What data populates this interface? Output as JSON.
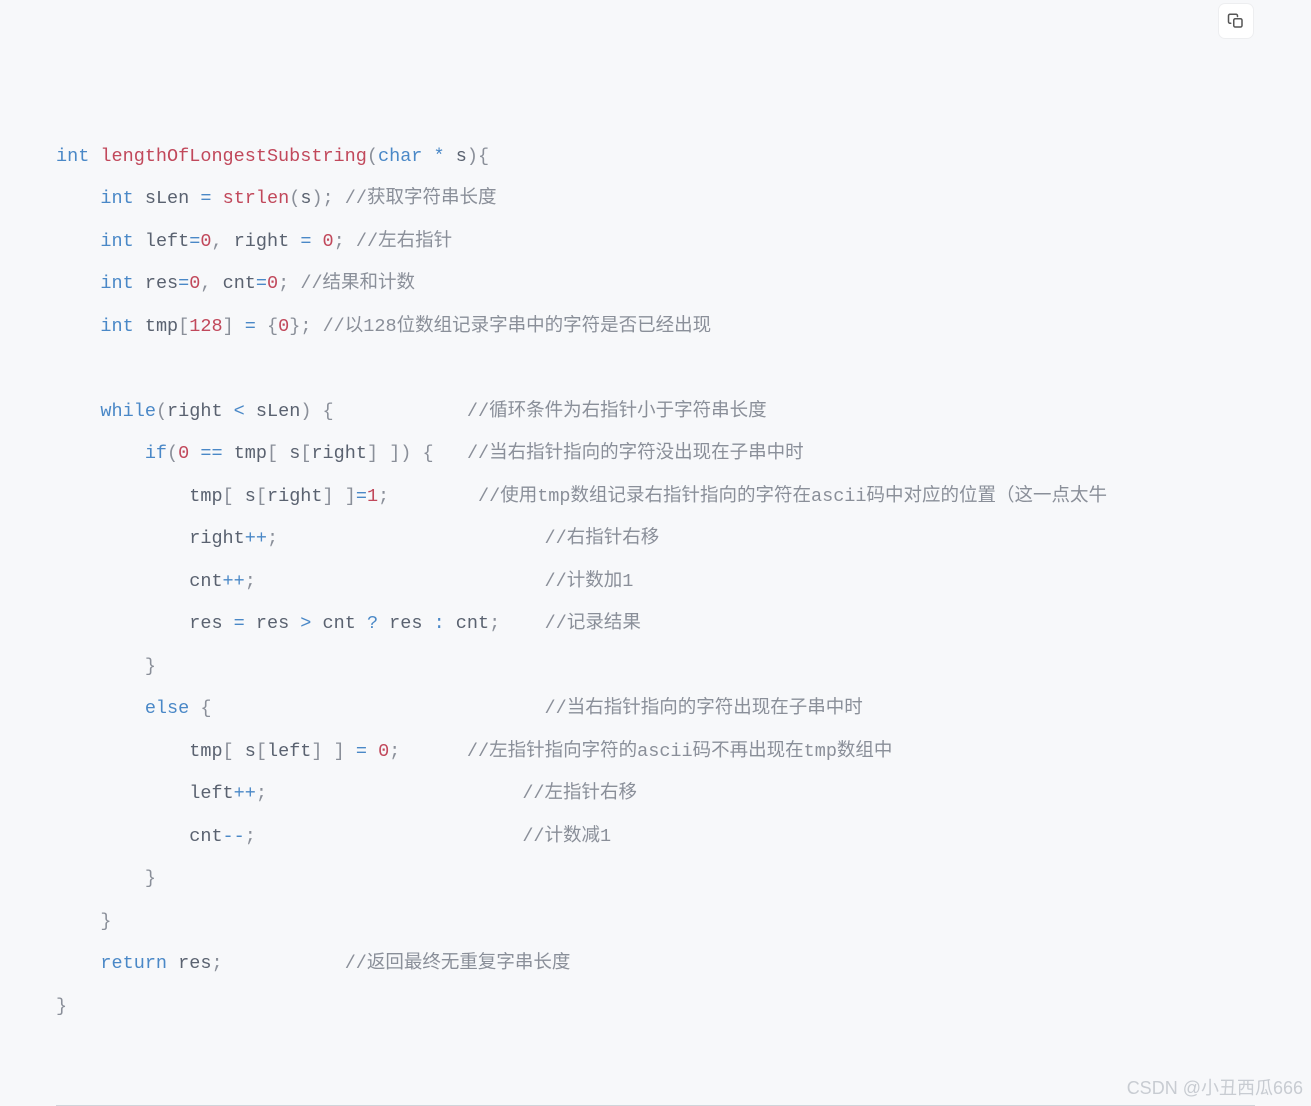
{
  "code": {
    "lines": [
      {
        "indent": 0,
        "tokens": [
          [
            "kw",
            "int"
          ],
          [
            "sp",
            " "
          ],
          [
            "fn",
            "lengthOfLongestSubstring"
          ],
          [
            "pn",
            "("
          ],
          [
            "kw",
            "char"
          ],
          [
            "sp",
            " "
          ],
          [
            "op",
            "*"
          ],
          [
            "sp",
            " "
          ],
          [
            "id",
            "s"
          ],
          [
            "pn",
            ")"
          ],
          [
            "pn",
            "{"
          ]
        ]
      },
      {
        "indent": 4,
        "tokens": [
          [
            "kw",
            "int"
          ],
          [
            "sp",
            " "
          ],
          [
            "id",
            "sLen"
          ],
          [
            "sp",
            " "
          ],
          [
            "op",
            "="
          ],
          [
            "sp",
            " "
          ],
          [
            "fn",
            "strlen"
          ],
          [
            "pn",
            "("
          ],
          [
            "id",
            "s"
          ],
          [
            "pn",
            ")"
          ],
          [
            "pn",
            ";"
          ],
          [
            "sp",
            " "
          ],
          [
            "cm",
            "//获取字符串长度"
          ]
        ]
      },
      {
        "indent": 4,
        "tokens": [
          [
            "kw",
            "int"
          ],
          [
            "sp",
            " "
          ],
          [
            "id",
            "left"
          ],
          [
            "op",
            "="
          ],
          [
            "num",
            "0"
          ],
          [
            "pn",
            ","
          ],
          [
            "sp",
            " "
          ],
          [
            "id",
            "right"
          ],
          [
            "sp",
            " "
          ],
          [
            "op",
            "="
          ],
          [
            "sp",
            " "
          ],
          [
            "num",
            "0"
          ],
          [
            "pn",
            ";"
          ],
          [
            "sp",
            " "
          ],
          [
            "cm",
            "//左右指针"
          ]
        ]
      },
      {
        "indent": 4,
        "tokens": [
          [
            "kw",
            "int"
          ],
          [
            "sp",
            " "
          ],
          [
            "id",
            "res"
          ],
          [
            "op",
            "="
          ],
          [
            "num",
            "0"
          ],
          [
            "pn",
            ","
          ],
          [
            "sp",
            " "
          ],
          [
            "id",
            "cnt"
          ],
          [
            "op",
            "="
          ],
          [
            "num",
            "0"
          ],
          [
            "pn",
            ";"
          ],
          [
            "sp",
            " "
          ],
          [
            "cm",
            "//结果和计数"
          ]
        ]
      },
      {
        "indent": 4,
        "tokens": [
          [
            "kw",
            "int"
          ],
          [
            "sp",
            " "
          ],
          [
            "id",
            "tmp"
          ],
          [
            "pn",
            "["
          ],
          [
            "num",
            "128"
          ],
          [
            "pn",
            "]"
          ],
          [
            "sp",
            " "
          ],
          [
            "op",
            "="
          ],
          [
            "sp",
            " "
          ],
          [
            "pn",
            "{"
          ],
          [
            "num",
            "0"
          ],
          [
            "pn",
            "}"
          ],
          [
            "pn",
            ";"
          ],
          [
            "sp",
            " "
          ],
          [
            "cm",
            "//以128位数组记录字串中的字符是否已经出现"
          ]
        ]
      },
      {
        "indent": 0,
        "tokens": []
      },
      {
        "indent": 4,
        "tokens": [
          [
            "kw",
            "while"
          ],
          [
            "pn",
            "("
          ],
          [
            "id",
            "right"
          ],
          [
            "sp",
            " "
          ],
          [
            "op",
            "<"
          ],
          [
            "sp",
            " "
          ],
          [
            "id",
            "sLen"
          ],
          [
            "pn",
            ")"
          ],
          [
            "sp",
            " "
          ],
          [
            "pn",
            "{"
          ],
          [
            "sp",
            "            "
          ],
          [
            "cm",
            "//循环条件为右指针小于字符串长度"
          ]
        ]
      },
      {
        "indent": 8,
        "tokens": [
          [
            "kw",
            "if"
          ],
          [
            "pn",
            "("
          ],
          [
            "num",
            "0"
          ],
          [
            "sp",
            " "
          ],
          [
            "op",
            "=="
          ],
          [
            "sp",
            " "
          ],
          [
            "id",
            "tmp"
          ],
          [
            "pn",
            "["
          ],
          [
            "sp",
            " "
          ],
          [
            "id",
            "s"
          ],
          [
            "pn",
            "["
          ],
          [
            "id",
            "right"
          ],
          [
            "pn",
            "]"
          ],
          [
            "sp",
            " "
          ],
          [
            "pn",
            "]"
          ],
          [
            "pn",
            ")"
          ],
          [
            "sp",
            " "
          ],
          [
            "pn",
            "{"
          ],
          [
            "sp",
            "   "
          ],
          [
            "cm",
            "//当右指针指向的字符没出现在子串中时"
          ]
        ]
      },
      {
        "indent": 12,
        "tokens": [
          [
            "id",
            "tmp"
          ],
          [
            "pn",
            "["
          ],
          [
            "sp",
            " "
          ],
          [
            "id",
            "s"
          ],
          [
            "pn",
            "["
          ],
          [
            "id",
            "right"
          ],
          [
            "pn",
            "]"
          ],
          [
            "sp",
            " "
          ],
          [
            "pn",
            "]"
          ],
          [
            "op",
            "="
          ],
          [
            "num",
            "1"
          ],
          [
            "pn",
            ";"
          ],
          [
            "sp",
            "        "
          ],
          [
            "cm",
            "//使用tmp数组记录右指针指向的字符在ascii码中对应的位置（这一点太牛"
          ]
        ]
      },
      {
        "indent": 12,
        "tokens": [
          [
            "id",
            "right"
          ],
          [
            "op",
            "++"
          ],
          [
            "pn",
            ";"
          ],
          [
            "sp",
            "                        "
          ],
          [
            "cm",
            "//右指针右移"
          ]
        ]
      },
      {
        "indent": 12,
        "tokens": [
          [
            "id",
            "cnt"
          ],
          [
            "op",
            "++"
          ],
          [
            "pn",
            ";"
          ],
          [
            "sp",
            "                          "
          ],
          [
            "cm",
            "//计数加1"
          ]
        ]
      },
      {
        "indent": 12,
        "tokens": [
          [
            "id",
            "res"
          ],
          [
            "sp",
            " "
          ],
          [
            "op",
            "="
          ],
          [
            "sp",
            " "
          ],
          [
            "id",
            "res"
          ],
          [
            "sp",
            " "
          ],
          [
            "op",
            ">"
          ],
          [
            "sp",
            " "
          ],
          [
            "id",
            "cnt"
          ],
          [
            "sp",
            " "
          ],
          [
            "op",
            "?"
          ],
          [
            "sp",
            " "
          ],
          [
            "id",
            "res"
          ],
          [
            "sp",
            " "
          ],
          [
            "op",
            ":"
          ],
          [
            "sp",
            " "
          ],
          [
            "id",
            "cnt"
          ],
          [
            "pn",
            ";"
          ],
          [
            "sp",
            "    "
          ],
          [
            "cm",
            "//记录结果"
          ]
        ]
      },
      {
        "indent": 8,
        "tokens": [
          [
            "pn",
            "}"
          ]
        ]
      },
      {
        "indent": 8,
        "tokens": [
          [
            "kw",
            "else"
          ],
          [
            "sp",
            " "
          ],
          [
            "pn",
            "{"
          ],
          [
            "sp",
            "                              "
          ],
          [
            "cm",
            "//当右指针指向的字符出现在子串中时"
          ]
        ]
      },
      {
        "indent": 12,
        "tokens": [
          [
            "id",
            "tmp"
          ],
          [
            "pn",
            "["
          ],
          [
            "sp",
            " "
          ],
          [
            "id",
            "s"
          ],
          [
            "pn",
            "["
          ],
          [
            "id",
            "left"
          ],
          [
            "pn",
            "]"
          ],
          [
            "sp",
            " "
          ],
          [
            "pn",
            "]"
          ],
          [
            "sp",
            " "
          ],
          [
            "op",
            "="
          ],
          [
            "sp",
            " "
          ],
          [
            "num",
            "0"
          ],
          [
            "pn",
            ";"
          ],
          [
            "sp",
            "      "
          ],
          [
            "cm",
            "//左指针指向字符的ascii码不再出现在tmp数组中"
          ]
        ]
      },
      {
        "indent": 12,
        "tokens": [
          [
            "id",
            "left"
          ],
          [
            "op",
            "++"
          ],
          [
            "pn",
            ";"
          ],
          [
            "sp",
            "                       "
          ],
          [
            "cm",
            "//左指针右移"
          ]
        ]
      },
      {
        "indent": 12,
        "tokens": [
          [
            "id",
            "cnt"
          ],
          [
            "op",
            "--"
          ],
          [
            "pn",
            ";"
          ],
          [
            "sp",
            "                        "
          ],
          [
            "cm",
            "//计数减1"
          ]
        ]
      },
      {
        "indent": 8,
        "tokens": [
          [
            "pn",
            "}"
          ]
        ]
      },
      {
        "indent": 4,
        "tokens": [
          [
            "pn",
            "}"
          ]
        ]
      },
      {
        "indent": 4,
        "tokens": [
          [
            "kw",
            "return"
          ],
          [
            "sp",
            " "
          ],
          [
            "id",
            "res"
          ],
          [
            "pn",
            ";"
          ],
          [
            "sp",
            "           "
          ],
          [
            "cm",
            "//返回最终无重复字串长度"
          ]
        ]
      },
      {
        "indent": 0,
        "tokens": [
          [
            "pn",
            "}"
          ]
        ]
      }
    ]
  },
  "watermark": "CSDN @小丑西瓜666"
}
